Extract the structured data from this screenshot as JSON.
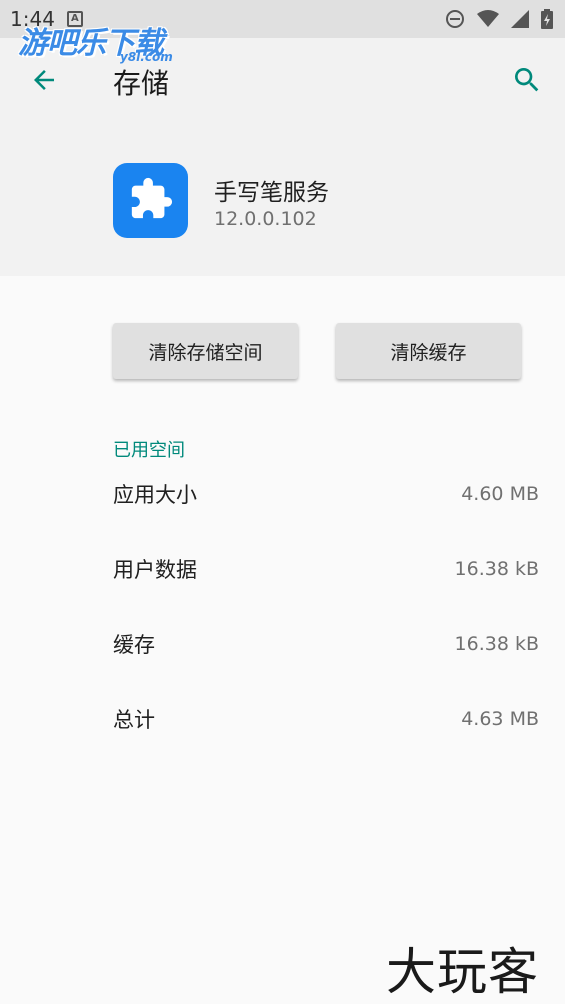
{
  "status_bar": {
    "time": "1:44",
    "notification_glyph": "A",
    "icons": [
      "do-not-disturb-icon",
      "wifi-icon",
      "signal-icon",
      "battery-icon"
    ]
  },
  "watermark_top": {
    "text": "游吧乐下载",
    "sub": "y8l.com"
  },
  "app_bar": {
    "back_icon": "arrow-left-icon",
    "title": "存储",
    "search_icon": "search-icon"
  },
  "app": {
    "icon": "puzzle-piece-icon",
    "name": "手写笔服务",
    "version": "12.0.0.102"
  },
  "buttons": {
    "clear_storage": "清除存储空间",
    "clear_cache": "清除缓存"
  },
  "section": {
    "title": "已用空间"
  },
  "rows": [
    {
      "label": "应用大小",
      "value": "4.60 MB"
    },
    {
      "label": "用户数据",
      "value": "16.38 kB"
    },
    {
      "label": "缓存",
      "value": "16.38 kB"
    },
    {
      "label": "总计",
      "value": "4.63 MB"
    }
  ],
  "watermark_bottom": {
    "text": "大玩客"
  },
  "colors": {
    "accent": "#00897b",
    "app_icon_bg": "#1a84f0",
    "header_bg": "#f2f2f2",
    "body_bg": "#fafafa",
    "button_bg": "#e0e0e0"
  }
}
